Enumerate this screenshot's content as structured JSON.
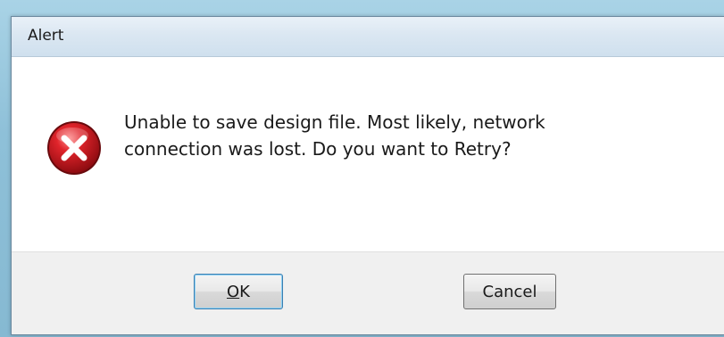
{
  "window": {
    "title": "Alert"
  },
  "icon": {
    "name": "error-icon",
    "colors": {
      "circle": "#c8141b",
      "circle_highlight": "#ff6b6b",
      "cross": "#ffffff"
    }
  },
  "message": {
    "line1": "Unable to save design file. Most likely, network",
    "line2": "connection was lost. Do you want to Retry?"
  },
  "buttons": {
    "ok": {
      "accelerator": "O",
      "rest": "K"
    },
    "cancel": {
      "label": "Cancel"
    }
  },
  "colors": {
    "desktop": "#8fc1d8",
    "dialog_bg": "#f0f0f0",
    "content_bg": "#ffffff",
    "focus_border": "#3c7fb1"
  }
}
